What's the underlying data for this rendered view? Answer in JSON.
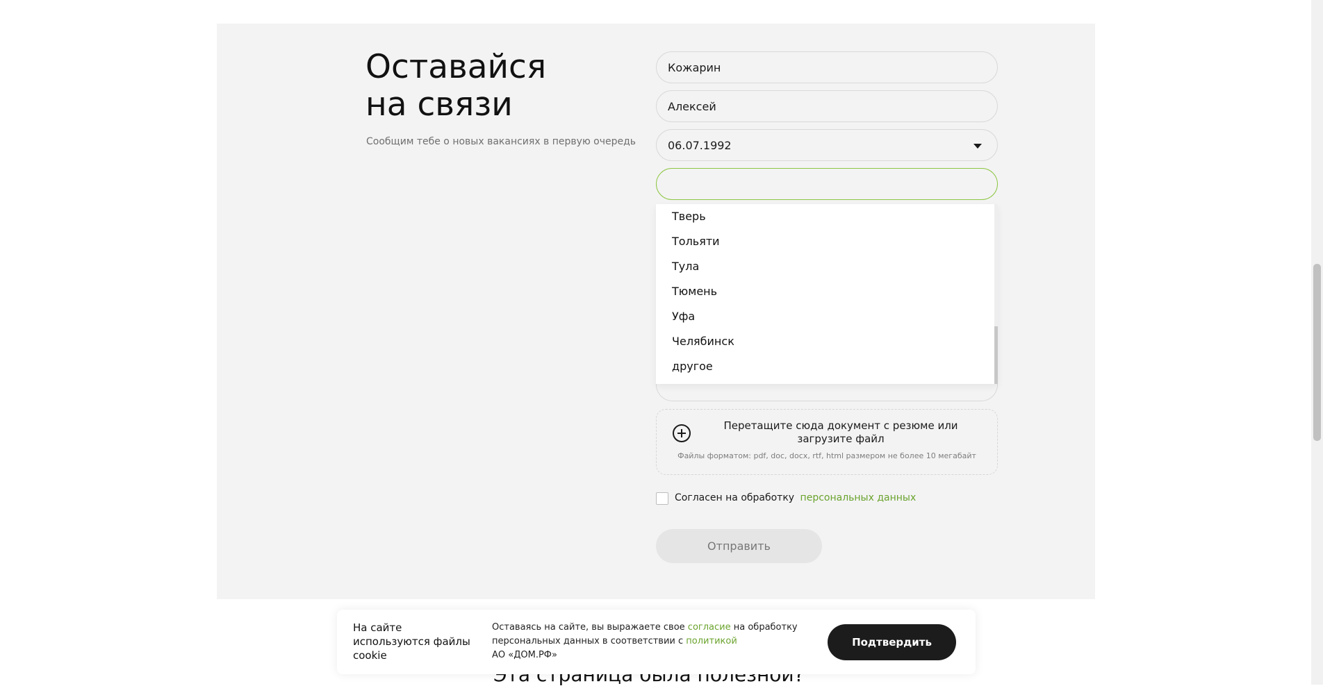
{
  "heading": {
    "line1": "Оставайся",
    "line2": "на связи"
  },
  "subtitle": "Сообщим тебе о новых вакансиях в первую очередь",
  "form": {
    "last_name": "Кожарин",
    "first_name": "Алексей",
    "birth_date": "06.07.1992",
    "city_value": "",
    "city_options": [
      "Тверь",
      "Тольяти",
      "Тула",
      "Тюмень",
      "Уфа",
      "Челябинск",
      "другое"
    ],
    "upload_title": "Перетащите сюда документ с резюме или загрузите файл",
    "upload_hint": "Файлы форматом: pdf, doc, docx, rtf, html размером не более 10 мегабайт",
    "consent_text": "Согласен на обработку",
    "consent_link": "персональных данных",
    "submit_label": "Отправить"
  },
  "cookie": {
    "title": "На сайте используются файлы cookie",
    "text_1": "Оставаясь на сайте, вы выражаете свое",
    "link_1": "согласие",
    "text_2": "на обработку персональных данных в соответствии с",
    "link_2": "политикой",
    "text_3": "АО «ДОМ.РФ»",
    "confirm_label": "Подтвердить"
  },
  "bottom_heading": "Эта страница была полезной?",
  "colors": {
    "accent": "#6aa32c",
    "active_border": "#8cc63f",
    "button_dark": "#1c1c1c"
  }
}
